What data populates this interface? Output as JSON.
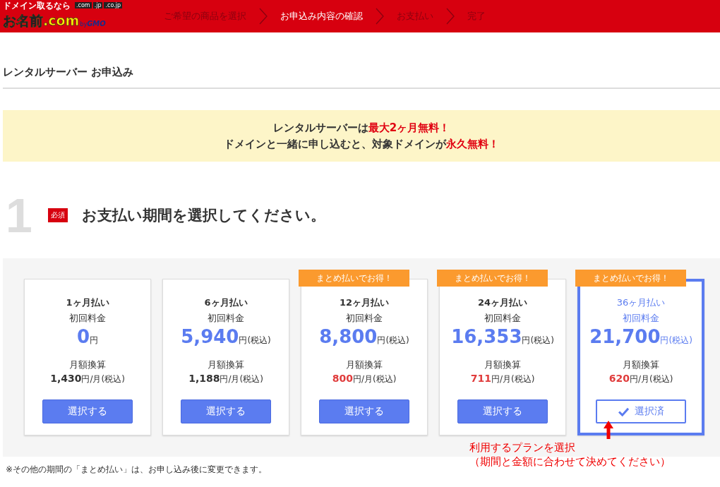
{
  "header": {
    "logo": {
      "tagline": "ドメイン取るなら",
      "name": "お名前.com",
      "tlds": [
        ".com",
        ".jp",
        ".co.jp"
      ],
      "by": "by",
      "company": "GMO"
    },
    "steps": [
      {
        "label": "ご希望の商品を選択",
        "selected": false
      },
      {
        "label": "お申込み内容の確認",
        "selected": true
      },
      {
        "label": "お支払い",
        "selected": false
      },
      {
        "label": "完了",
        "selected": false
      }
    ]
  },
  "page_title": "レンタルサーバー お申込み",
  "banner": [
    "レンタルサーバーは**最大2ヶ月無料！**",
    "ドメインと一緒に申し込むと、対象ドメインが**永久無料！**"
  ],
  "section": {
    "number": "1",
    "required_badge": "必須",
    "title": "お支払い期間を選択してください。"
  },
  "plans": [
    {
      "period": "1ヶ月払い",
      "first_label": "初回料金",
      "price": "0",
      "price_unit": "円",
      "monthly_label": "月額換算",
      "monthly": "1,430",
      "monthly_unit": "円/月(税込)",
      "highlight": false,
      "button": "選択する",
      "selected": false
    },
    {
      "period": "6ヶ月払い",
      "first_label": "初回料金",
      "price": "5,940",
      "price_unit": "円",
      "price_tax": "(税込)",
      "monthly_label": "月額換算",
      "monthly": "1,188",
      "monthly_unit": "円/月(税込)",
      "highlight": false,
      "button": "選択する",
      "selected": false
    },
    {
      "ribbon": "まとめ払いでお得！",
      "period": "12ヶ月払い",
      "first_label": "初回料金",
      "price": "8,800",
      "price_unit": "円",
      "price_tax": "(税込)",
      "monthly_label": "月額換算",
      "monthly": "800",
      "monthly_unit": "円/月(税込)",
      "highlight": true,
      "button": "選択する",
      "selected": false
    },
    {
      "ribbon": "まとめ払いでお得！",
      "period": "24ヶ月払い",
      "first_label": "初回料金",
      "price": "16,353",
      "price_unit": "円",
      "price_tax": "(税込)",
      "monthly_label": "月額換算",
      "monthly": "711",
      "monthly_unit": "円/月(税込)",
      "highlight": true,
      "button": "選択する",
      "selected": false
    },
    {
      "ribbon": "まとめ払いでお得！",
      "period": "36ヶ月払い",
      "first_label": "初回料金",
      "price": "21,700",
      "price_unit": "円",
      "price_tax": "(税込)",
      "monthly_label": "月額換算",
      "monthly": "620",
      "monthly_unit": "円/月(税込)",
      "highlight": true,
      "button": "選択済",
      "selected": true
    }
  ],
  "annotation": [
    "利用するプランを選択",
    "（期間と金額に合わせて決めてください）"
  ],
  "footnote": "※その他の期間の「まとめ払い」は、お申し込み後に変更できます。"
}
